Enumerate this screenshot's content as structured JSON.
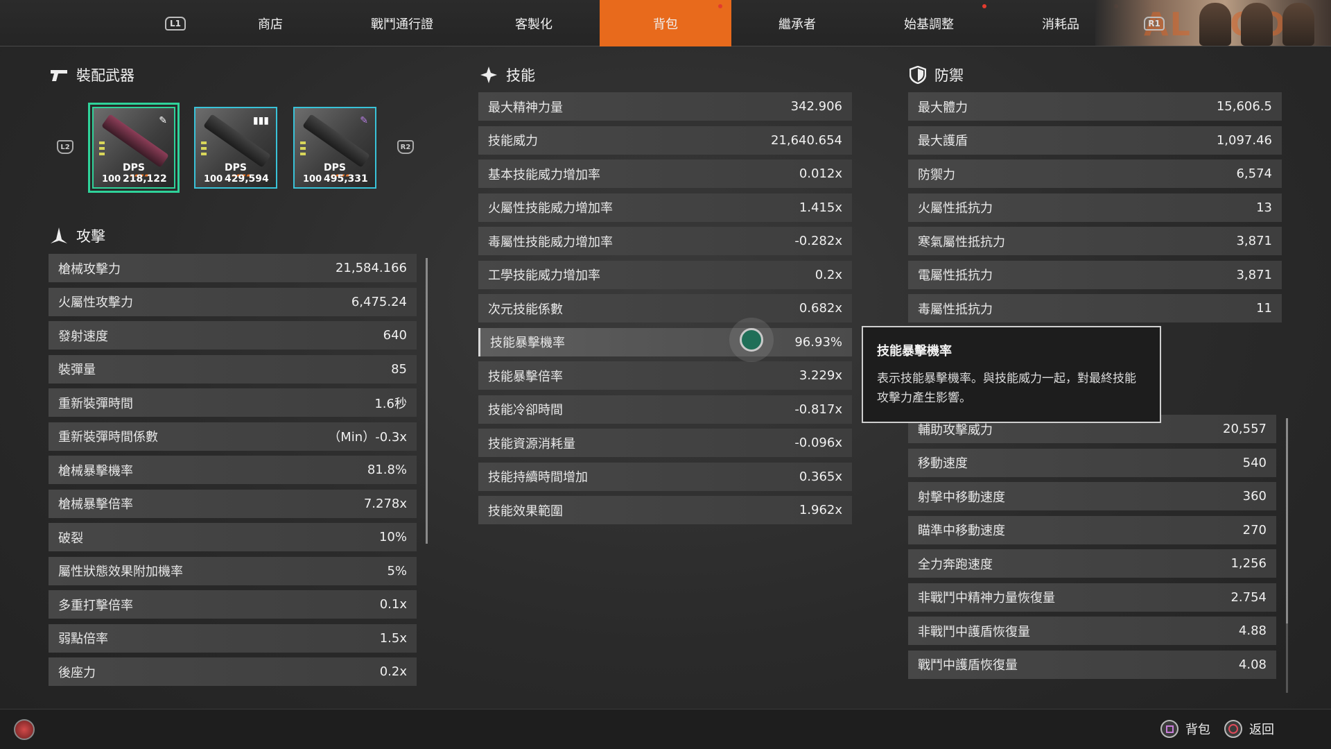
{
  "nav": {
    "left_bumper": "L1",
    "right_bumper": "R1",
    "tabs": [
      "商店",
      "戰鬥通行證",
      "客製化",
      "背包",
      "繼承者",
      "始基調整",
      "消耗品"
    ],
    "active_tab": "背包",
    "banner_text": "AL BOON"
  },
  "weapons": {
    "title": "裝配武器",
    "left_shoulder": "L2",
    "right_shoulder": "R2",
    "items": [
      {
        "level": "100",
        "dps_label": "DPS",
        "dps": "218,122"
      },
      {
        "level": "100",
        "dps_label": "DPS",
        "dps": "429,594"
      },
      {
        "level": "100",
        "dps_label": "DPS",
        "dps": "495,331"
      }
    ]
  },
  "attack": {
    "title": "攻擊",
    "rows": [
      {
        "label": "槍械攻擊力",
        "value": "21,584.166"
      },
      {
        "label": "火屬性攻擊力",
        "value": "6,475.24"
      },
      {
        "label": "發射速度",
        "value": "640"
      },
      {
        "label": "裝彈量",
        "value": "85"
      },
      {
        "label": "重新裝彈時間",
        "value": "1.6秒"
      },
      {
        "label": "重新裝彈時間係數",
        "value": "（Min）-0.3x"
      },
      {
        "label": "槍械暴擊機率",
        "value": "81.8%"
      },
      {
        "label": "槍械暴擊倍率",
        "value": "7.278x"
      },
      {
        "label": "破裂",
        "value": "10%"
      },
      {
        "label": "屬性狀態效果附加機率",
        "value": "5%"
      },
      {
        "label": "多重打擊倍率",
        "value": "0.1x"
      },
      {
        "label": "弱點倍率",
        "value": "1.5x"
      },
      {
        "label": "後座力",
        "value": "0.2x"
      }
    ]
  },
  "skill": {
    "title": "技能",
    "rows": [
      {
        "label": "最大精神力量",
        "value": "342.906"
      },
      {
        "label": "技能威力",
        "value": "21,640.654"
      },
      {
        "label": "基本技能威力增加率",
        "value": "0.012x"
      },
      {
        "label": "火屬性技能威力增加率",
        "value": "1.415x"
      },
      {
        "label": "毒屬性技能威力增加率",
        "value": "-0.282x"
      },
      {
        "label": "工學技能威力增加率",
        "value": "0.2x"
      },
      {
        "label": "次元技能係數",
        "value": "0.682x"
      },
      {
        "label": "技能暴擊機率",
        "value": "96.93%"
      },
      {
        "label": "技能暴擊倍率",
        "value": "3.229x"
      },
      {
        "label": "技能冷卻時間",
        "value": "-0.817x"
      },
      {
        "label": "技能資源消耗量",
        "value": "-0.096x"
      },
      {
        "label": "技能持續時間增加",
        "value": "0.365x"
      },
      {
        "label": "技能效果範圍",
        "value": "1.962x"
      }
    ]
  },
  "defense": {
    "title": "防禦",
    "rows_top": [
      {
        "label": "最大體力",
        "value": "15,606.5"
      },
      {
        "label": "最大護盾",
        "value": "1,097.46"
      },
      {
        "label": "防禦力",
        "value": "6,574"
      },
      {
        "label": "火屬性抵抗力",
        "value": "13"
      },
      {
        "label": "寒氣屬性抵抗力",
        "value": "3,871"
      },
      {
        "label": "電屬性抵抗力",
        "value": "3,871"
      },
      {
        "label": "毒屬性抵抗力",
        "value": "11"
      }
    ],
    "rows_bottom": [
      {
        "label": "輔助攻擊威力",
        "value": "20,557"
      },
      {
        "label": "移動速度",
        "value": "540"
      },
      {
        "label": "射擊中移動速度",
        "value": "360"
      },
      {
        "label": "瞄準中移動速度",
        "value": "270"
      },
      {
        "label": "全力奔跑速度",
        "value": "1,256"
      },
      {
        "label": "非戰鬥中精神力量恢復量",
        "value": "2.754"
      },
      {
        "label": "非戰鬥中護盾恢復量",
        "value": "4.88"
      },
      {
        "label": "戰鬥中護盾恢復量",
        "value": "4.08"
      }
    ]
  },
  "tooltip": {
    "title": "技能暴擊機率",
    "body": "表示技能暴擊機率。與技能威力一起，對最終技能攻擊力產生影響。"
  },
  "footer": {
    "inventory_label": "背包",
    "back_label": "返回"
  }
}
